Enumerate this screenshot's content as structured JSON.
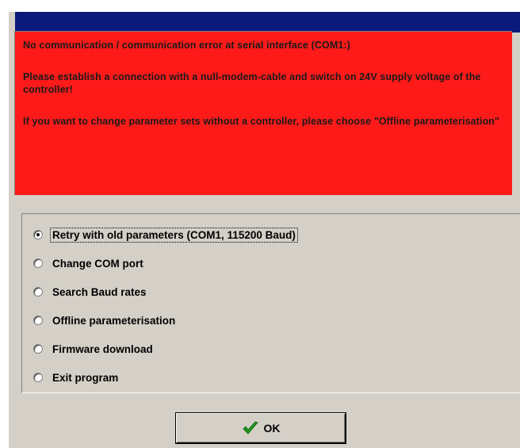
{
  "error": {
    "line1": "No communication / communication error at serial interface (COM1:)",
    "line2": "Please establish a connection with a null-modem-cable and switch on 24V supply voltage of the controller!",
    "line3": "If you want to change parameter sets without a controller, please choose \"Offline parameterisation\""
  },
  "options": [
    {
      "label": "Retry with old parameters (COM1, 115200 Baud)",
      "checked": true
    },
    {
      "label": "Change COM port",
      "checked": false
    },
    {
      "label": "Search Baud rates",
      "checked": false
    },
    {
      "label": "Offline parameterisation",
      "checked": false
    },
    {
      "label": "Firmware download",
      "checked": false
    },
    {
      "label": "Exit program",
      "checked": false
    }
  ],
  "ok_button": {
    "label": "OK",
    "icon": "checkmark-icon"
  },
  "colors": {
    "error_bg": "#ff1a1a",
    "titlebar": "#0a1a7a",
    "dialog_bg": "#d4d0c8",
    "check_green": "#1f9a1f"
  }
}
